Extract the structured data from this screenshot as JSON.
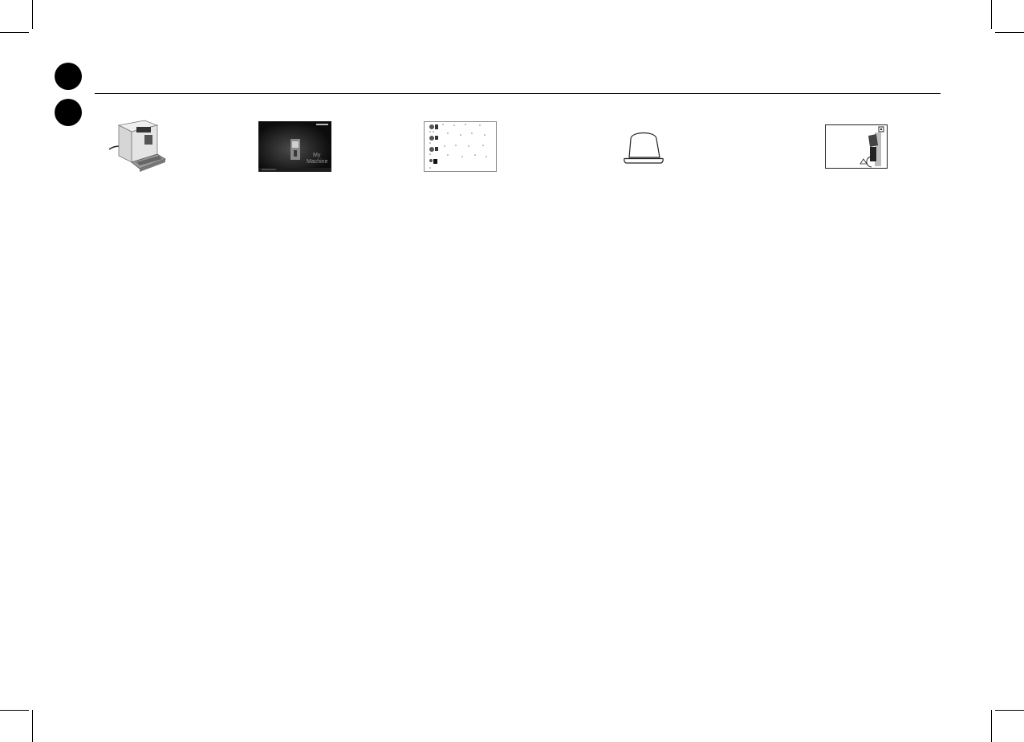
{
  "page": {
    "illustrations": [
      {
        "icon": "coffee-machine-icon"
      },
      {
        "icon": "welcome-booklet-icon"
      },
      {
        "icon": "instruction-sheet-icon"
      },
      {
        "icon": "capsule-icon"
      },
      {
        "icon": "machine-card-icon"
      }
    ]
  },
  "booklet": {
    "line1": "My",
    "line2": "Machine"
  },
  "colors": {
    "ink": "#000000",
    "paper": "#ffffff",
    "booklet_bg": "#111111",
    "machine_gray": "#cfcfcf"
  }
}
